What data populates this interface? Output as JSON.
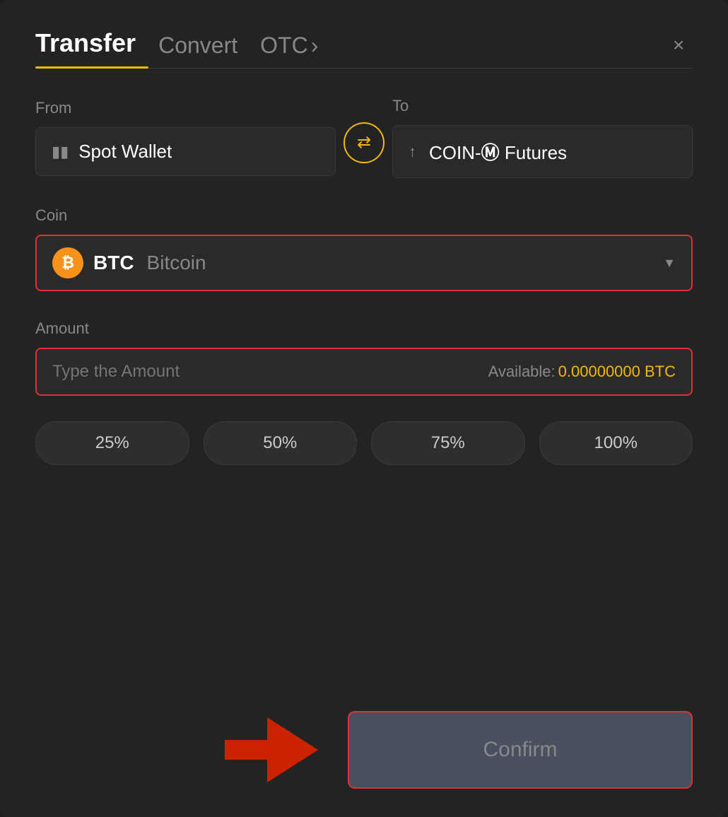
{
  "header": {
    "tab_transfer": "Transfer",
    "tab_convert": "Convert",
    "tab_otc": "OTC",
    "tab_otc_chevron": "›",
    "close_label": "×"
  },
  "from_section": {
    "label": "From",
    "wallet_name": "Spot Wallet"
  },
  "to_section": {
    "label": "To",
    "wallet_name": "COIN-",
    "wallet_name2": "Ⓜ",
    "wallet_name3": " Futures"
  },
  "coin_section": {
    "label": "Coin",
    "coin_symbol": "BTC",
    "coin_name": "Bitcoin",
    "dropdown_arrow": "▼"
  },
  "amount_section": {
    "label": "Amount",
    "placeholder": "Type the Amount",
    "available_label": "Available:",
    "available_value": "0.00000000 BTC"
  },
  "percent_buttons": [
    "25%",
    "50%",
    "75%",
    "100%"
  ],
  "confirm_button": {
    "label": "Confirm"
  }
}
